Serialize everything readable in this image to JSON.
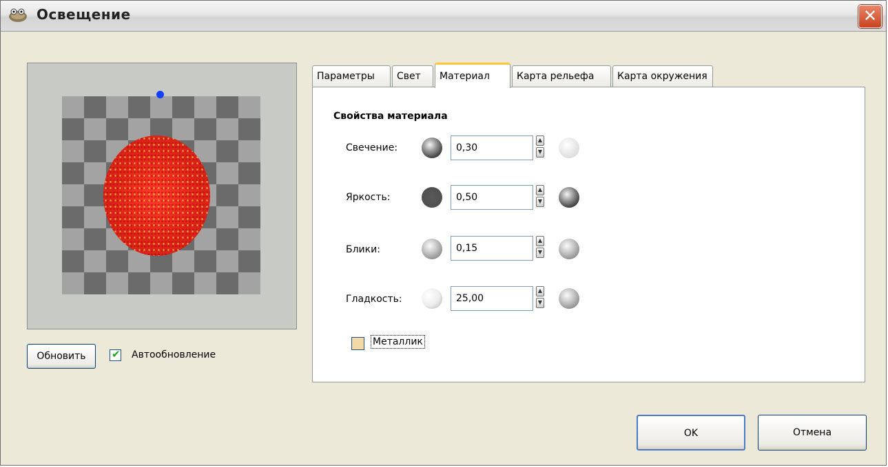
{
  "window": {
    "title": "Освещение",
    "close": "✕"
  },
  "preview": {
    "update_button": "Обновить",
    "auto_update": {
      "label": "Автообновление",
      "checked": true
    }
  },
  "tabs": [
    {
      "label": "Параметры",
      "active": false
    },
    {
      "label": "Свет",
      "active": false
    },
    {
      "label": "Материал",
      "active": true
    },
    {
      "label": "Карта рельефа",
      "active": false
    },
    {
      "label": "Карта окружения",
      "active": false
    }
  ],
  "material": {
    "section_title": "Свойства материала",
    "rows": [
      {
        "label": "Свечение:",
        "value": "0,30",
        "left_icon": "sphere-glow-low-icon",
        "right_icon": "sphere-glow-high-icon"
      },
      {
        "label": "Яркость:",
        "value": "0,50",
        "left_icon": "sphere-brightness-low-icon",
        "right_icon": "sphere-brightness-high-icon"
      },
      {
        "label": "Блики:",
        "value": "0,15",
        "left_icon": "sphere-highlights-low-icon",
        "right_icon": "sphere-highlights-high-icon"
      },
      {
        "label": "Гладкость:",
        "value": "25,00",
        "left_icon": "sphere-smoothness-low-icon",
        "right_icon": "sphere-smoothness-high-icon"
      }
    ],
    "metallic": {
      "label": "Металлик",
      "checked": false
    }
  },
  "buttons": {
    "ok": "OK",
    "cancel": "Отмена"
  }
}
